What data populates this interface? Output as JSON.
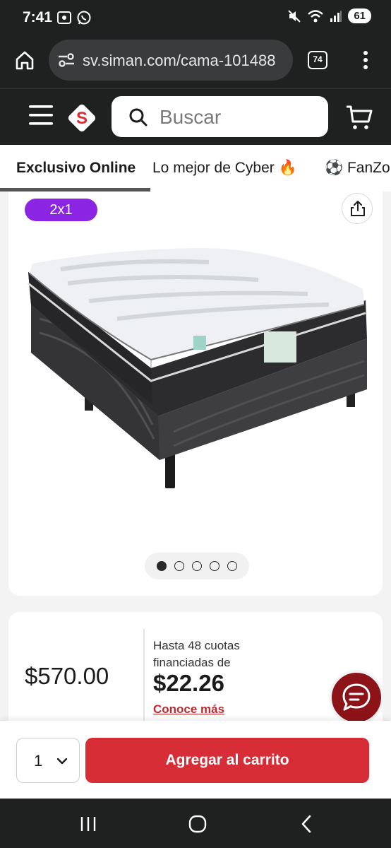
{
  "status_bar": {
    "time": "7:41",
    "battery": "61"
  },
  "browser": {
    "url": "sv.siman.com/cama-101488",
    "tab_count": "74"
  },
  "header": {
    "logo_letter": "S",
    "search_placeholder": "Buscar"
  },
  "categories": [
    {
      "label": "Exclusivo Online"
    },
    {
      "label": "Lo mejor de Cyber 🔥"
    },
    {
      "label": "⚽ FanZo"
    }
  ],
  "product": {
    "promo_badge": "2x1",
    "gallery_count": 5,
    "gallery_active": 1
  },
  "pricing": {
    "price": "$570.00",
    "cuotas_label": "Hasta 48 cuotas financiadas de",
    "cuota_amount": "$22.26",
    "more_link": "Conoce más"
  },
  "cart": {
    "quantity": "1",
    "add_button": "Agregar al carrito"
  },
  "colors": {
    "brand_red": "#d72d36",
    "promo_purple": "#8b25e3",
    "header_dark": "#1f2020"
  },
  "icons": [
    "home-icon",
    "site-settings-icon",
    "tabs-icon",
    "more-vert-icon",
    "menu-icon",
    "search-icon",
    "cart-icon",
    "share-icon",
    "chat-icon",
    "chevron-down-icon"
  ]
}
